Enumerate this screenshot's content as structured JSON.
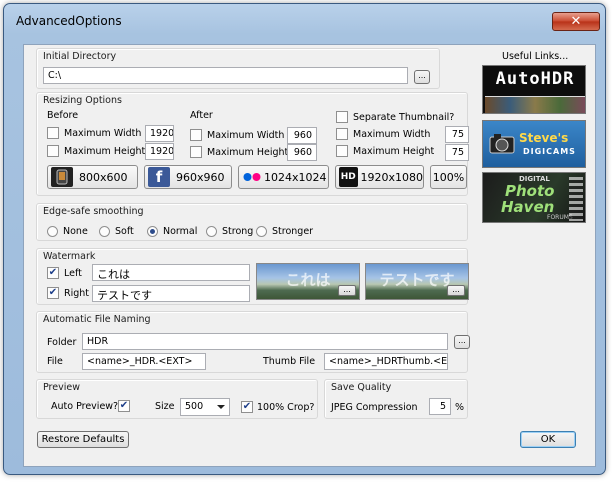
{
  "window": {
    "title": "AdvancedOptions",
    "close_glyph": "✕"
  },
  "initial_directory": {
    "legend": "Initial Directory",
    "value": "C:\\",
    "browse_label": "..."
  },
  "resizing": {
    "legend": "Resizing Options",
    "before": {
      "label": "Before",
      "max_width": {
        "label": "Maximum Width",
        "value": "1920",
        "checked": false
      },
      "max_height": {
        "label": "Maximum Height",
        "value": "1920",
        "checked": false
      }
    },
    "after": {
      "label": "After",
      "max_width": {
        "label": "Maximum Width",
        "value": "960",
        "checked": false
      },
      "max_height": {
        "label": "Maximum Height",
        "value": "960",
        "checked": false
      }
    },
    "thumb": {
      "label": "Separate Thumbnail?",
      "checked": false,
      "max_width": {
        "label": "Maximum Width",
        "value": "75",
        "checked": false
      },
      "max_height": {
        "label": "Maximum Height",
        "value": "75",
        "checked": false
      }
    },
    "presets": [
      {
        "label": "800x600",
        "icon": "phone-icon"
      },
      {
        "label": "960x960",
        "icon": "facebook-icon"
      },
      {
        "label": "1024x1024",
        "icon": "flickr-icon"
      },
      {
        "label": "1920x1080",
        "icon": "hd-icon"
      },
      {
        "label": "100%",
        "icon": ""
      }
    ]
  },
  "smoothing": {
    "legend": "Edge-safe smoothing",
    "options": [
      "None",
      "Soft",
      "Normal",
      "Strong",
      "Stronger"
    ],
    "selected": "Normal"
  },
  "watermark": {
    "legend": "Watermark",
    "left": {
      "label": "Left",
      "value": "これは",
      "checked": true,
      "preview": "これは"
    },
    "right": {
      "label": "Right",
      "value": "テストです",
      "checked": true,
      "preview": "テストです"
    },
    "browse_label": "..."
  },
  "naming": {
    "legend": "Automatic File Naming",
    "folder_label": "Folder",
    "folder_value": "HDR",
    "browse_label": "...",
    "file_label": "File",
    "file_value": "<name>_HDR.<EXT>",
    "thumb_label": "Thumb File",
    "thumb_value": "<name>_HDRThumb.<EXT>"
  },
  "preview": {
    "legend": "Preview",
    "auto_label": "Auto Preview?",
    "auto_checked": true,
    "size_label": "Size",
    "size_value": "500",
    "crop_label": "100% Crop?",
    "crop_checked": true
  },
  "quality": {
    "legend": "Save Quality",
    "label": "JPEG Compression",
    "value": "5",
    "unit": "%"
  },
  "useful_links": {
    "title": "Useful Links...",
    "autohdr": "AutoHDR",
    "steves_line1": "Steve's",
    "steves_line2": "DIGICAMS",
    "digital": "DIGITAL",
    "photo": "Photo",
    "haven": "Haven",
    "forums": "FORUMS"
  },
  "buttons": {
    "restore": "Restore Defaults",
    "ok": "OK"
  },
  "colors": {
    "accent": "#2c4b8b",
    "close": "#c9482e",
    "facebook": "#3b5998",
    "flickr_blue": "#0063dc",
    "flickr_pink": "#ff0084"
  }
}
